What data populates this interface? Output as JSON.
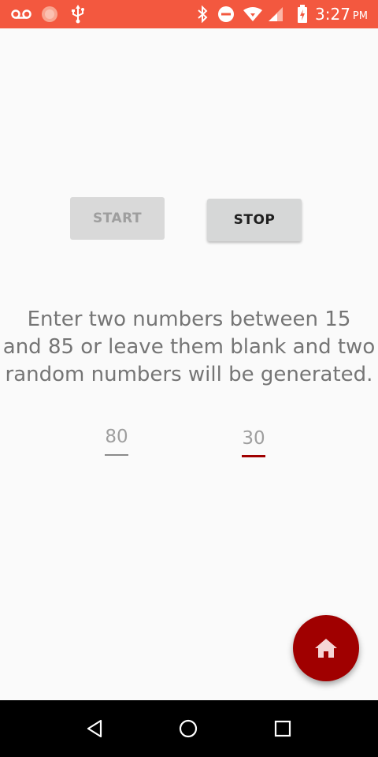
{
  "status_bar": {
    "time": "3:27",
    "ampm": "PM",
    "background_color": "#f3583f",
    "icons": [
      "voicemail-icon",
      "notification-dot-icon",
      "usb-icon",
      "bluetooth-icon",
      "do-not-disturb-icon",
      "wifi-icon",
      "signal-icon",
      "battery-charging-icon"
    ]
  },
  "controls": {
    "start_label": "START",
    "stop_label": "STOP"
  },
  "instruction": {
    "line1": "Enter two numbers between 15",
    "line2": "and 85 or leave them blank and two",
    "line3": "random numbers will be generated."
  },
  "inputs": {
    "first_value": "80",
    "second_value": "30"
  },
  "fab": {
    "icon": "home-icon",
    "color": "#a00000"
  },
  "nav_bar": {
    "icons": [
      "back-icon",
      "home-circle-icon",
      "recents-icon"
    ]
  }
}
